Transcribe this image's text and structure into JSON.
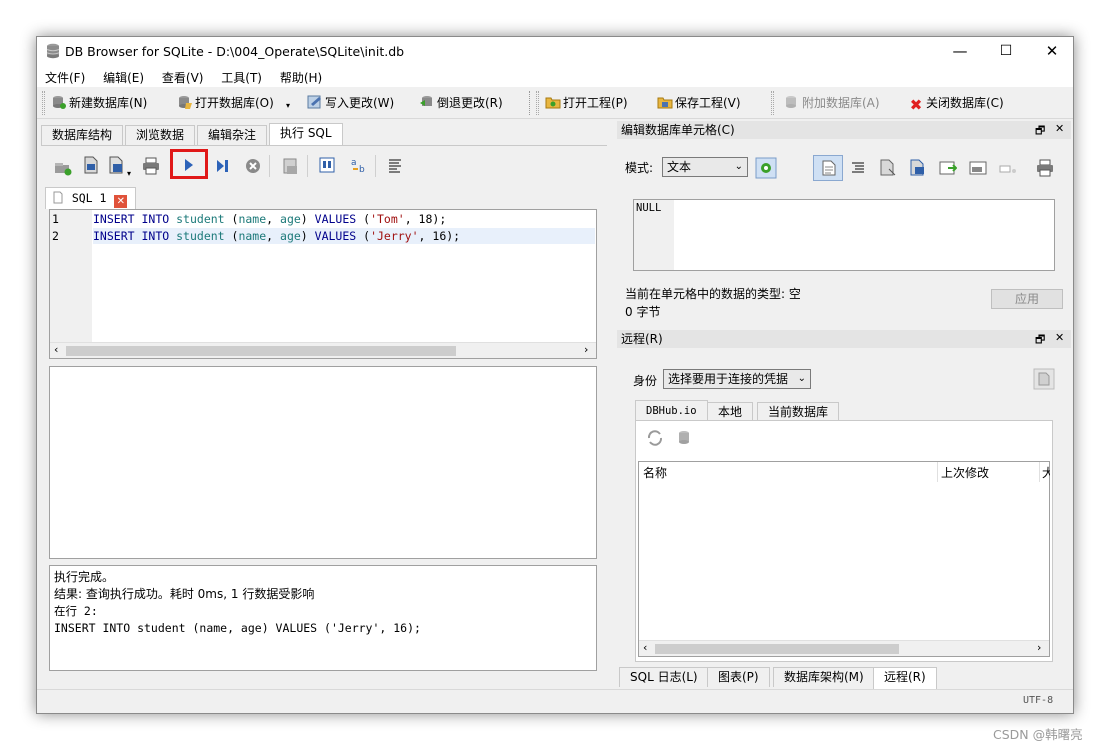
{
  "window": {
    "title": "DB Browser for SQLite - D:\\004_Operate\\SQLite\\init.db",
    "minimize": "—",
    "maximize": "☐",
    "close": "✕"
  },
  "menu": {
    "file": "文件(F)",
    "edit": "编辑(E)",
    "view": "查看(V)",
    "tools": "工具(T)",
    "help": "帮助(H)"
  },
  "toolbar": {
    "new_db": "新建数据库(N)",
    "open_db": "打开数据库(O)",
    "write_changes": "写入更改(W)",
    "revert_changes": "倒退更改(R)",
    "open_project": "打开工程(P)",
    "save_project": "保存工程(V)",
    "attach_db": "附加数据库(A)",
    "close_db": "关闭数据库(C)"
  },
  "main_tabs": {
    "structure": "数据库结构",
    "browse": "浏览数据",
    "pragmas": "编辑杂注",
    "execute_sql": "执行 SQL"
  },
  "sql_tab": {
    "label": "SQL 1"
  },
  "editor": {
    "lines": [
      {
        "num": "1",
        "parts": [
          "INSERT",
          " ",
          "INTO",
          " ",
          "student",
          " (",
          "name",
          ", ",
          "age",
          ") ",
          "VALUES",
          " (",
          "'Tom'",
          ", ",
          "18",
          ");"
        ]
      },
      {
        "num": "2",
        "parts": [
          "INSERT",
          " ",
          "INTO",
          " ",
          "student",
          " (",
          "name",
          ", ",
          "age",
          ") ",
          "VALUES",
          " (",
          "'Jerry'",
          ", ",
          "16",
          ");"
        ]
      }
    ]
  },
  "result_message": {
    "line1": "执行完成。",
    "line2": "结果: 查询执行成功。耗时 0ms, 1 行数据受影响",
    "line3": "在行 2:",
    "line4": "INSERT INTO student (name, age) VALUES ('Jerry', 16);"
  },
  "edit_cell": {
    "title": "编辑数据库单元格(C)",
    "mode_label": "模式:",
    "mode_value": "文本",
    "cell_value": "NULL",
    "type_info": "当前在单元格中的数据的类型: 空",
    "size_info": "0 字节",
    "apply": "应用"
  },
  "remote": {
    "title": "远程(R)",
    "identity_label": "身份",
    "identity_value": "选择要用于连接的凭据",
    "tabs": {
      "dbhub": "DBHub.io",
      "local": "本地",
      "current_db": "当前数据库"
    },
    "columns": {
      "name": "名称",
      "last_modified": "上次修改",
      "size_partial": "大"
    }
  },
  "bottom_tabs": {
    "sql_log": "SQL 日志(L)",
    "plot": "图表(P)",
    "schema": "数据库架构(M)",
    "remote": "远程(R)"
  },
  "status": {
    "encoding": "UTF-8"
  },
  "watermark": "CSDN @韩曙亮",
  "dock_controls": {
    "float": "🗗",
    "close": "✕"
  }
}
